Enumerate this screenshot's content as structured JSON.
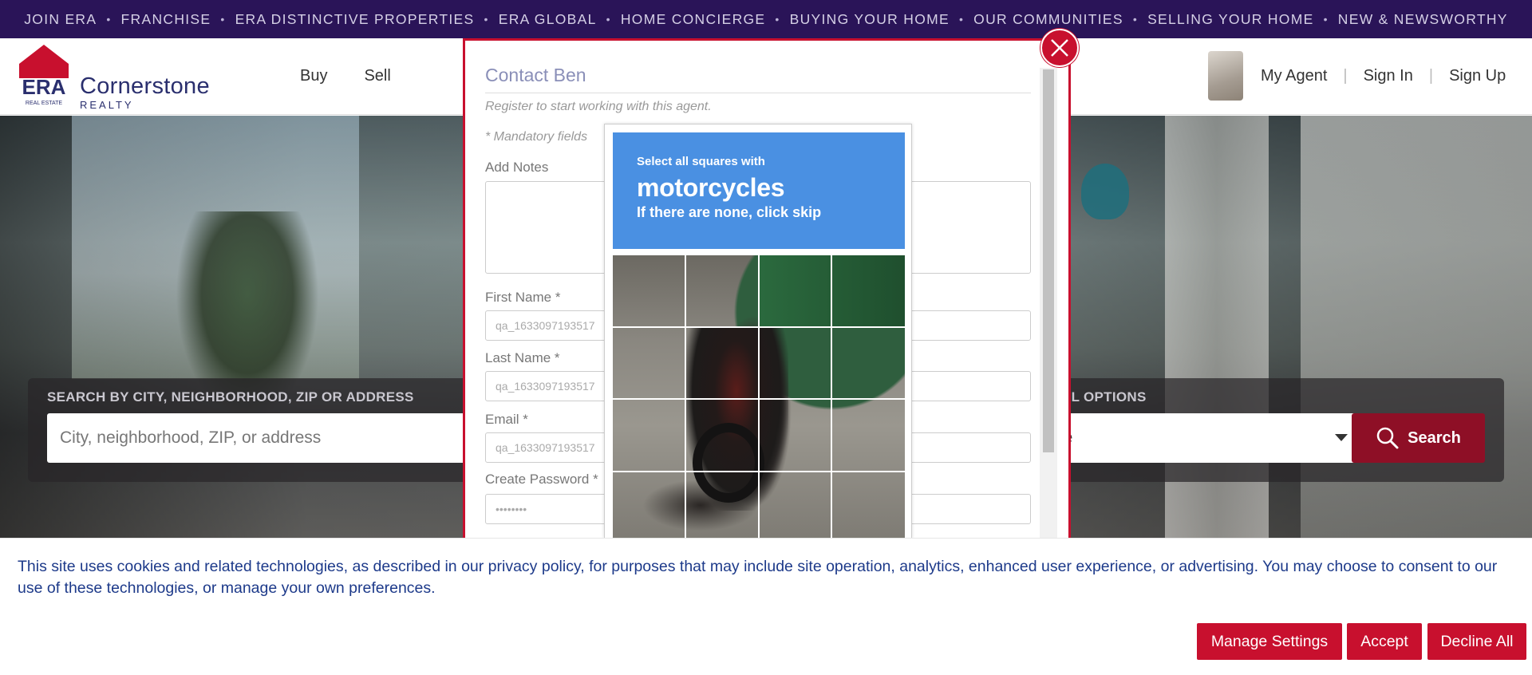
{
  "topnav": {
    "items": [
      "JOIN ERA",
      "FRANCHISE",
      "ERA DISTINCTIVE PROPERTIES",
      "ERA GLOBAL",
      "HOME CONCIERGE",
      "BUYING YOUR HOME",
      "OUR COMMUNITIES",
      "SELLING YOUR HOME",
      "NEW & NEWSWORTHY"
    ],
    "separator": "•"
  },
  "header": {
    "logo": {
      "mark": "ERA",
      "mark_sub": "REAL ESTATE",
      "name": "Cornerstone",
      "sub": "REALTY"
    },
    "nav": [
      "Buy",
      "Sell"
    ],
    "user_links": [
      "My Agent",
      "Sign In",
      "Sign Up"
    ],
    "separator": "|"
  },
  "search": {
    "label": "SEARCH BY CITY, NEIGHBORHOOD, ZIP OR ADDRESS",
    "placeholder": "City, neighborhood, ZIP, or address",
    "options_label": "AL OPTIONS",
    "select_value": "de",
    "button_label": "Search"
  },
  "modal": {
    "title": "Contact Ben",
    "subtitle": "Register to start working with this agent.",
    "mandatory": "* Mandatory fields",
    "notes_label": "Add Notes",
    "fields": [
      {
        "label": "First Name *",
        "value": "qa_1633097193517"
      },
      {
        "label": "Last Name *",
        "value": "qa_1633097193517"
      },
      {
        "label": "Email *",
        "value": "qa_1633097193517"
      },
      {
        "label": "Create Password *",
        "value": "••••••••"
      }
    ]
  },
  "captcha": {
    "instruction": "Select all squares with",
    "target": "motorcycles",
    "hint": "If there are none, click skip"
  },
  "cookie": {
    "text": "This site uses cookies and related technologies, as described in our privacy policy, for purposes that may include site operation, analytics, enhanced user experience, or advertising. You may choose to consent to our use of these technologies, or manage your own preferences.",
    "buttons": [
      "Manage Settings",
      "Accept",
      "Decline All"
    ]
  },
  "colors": {
    "topnav_bg": "#2a1458",
    "brand_red": "#c8102e",
    "search_button": "#8e0f26",
    "captcha_blue": "#4a90e2",
    "cookie_text": "#1d3a8a"
  }
}
